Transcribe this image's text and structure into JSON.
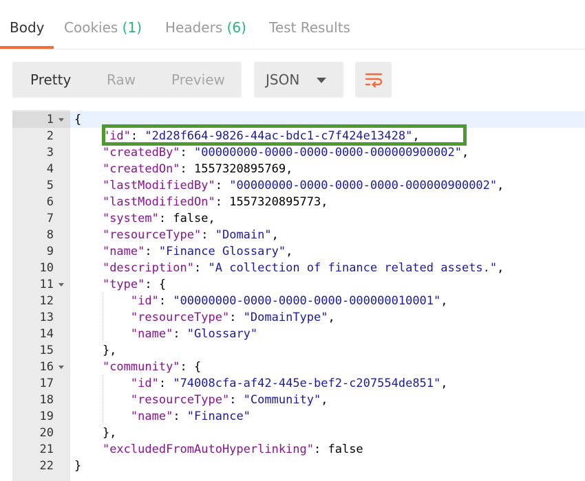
{
  "tabs": [
    {
      "label": "Body",
      "count": "",
      "active": true
    },
    {
      "label": "Cookies",
      "count": "(1)",
      "active": false
    },
    {
      "label": "Headers",
      "count": "(6)",
      "active": false
    },
    {
      "label": "Test Results",
      "count": "",
      "active": false
    }
  ],
  "view_modes": [
    "Pretty",
    "Raw",
    "Preview"
  ],
  "format_select": {
    "value": "JSON"
  },
  "wrap_button": {
    "icon": "wrap-lines-icon",
    "color": "#f26b3a"
  },
  "colors": {
    "accent": "#f26b3a",
    "count": "#26b47f",
    "key": "#881391",
    "string": "#1a1aa6",
    "highlight": "#4f9a30"
  },
  "editor": {
    "lines": [
      "1",
      "2",
      "3",
      "4",
      "5",
      "6",
      "7",
      "8",
      "9",
      "10",
      "11",
      "12",
      "13",
      "14",
      "15",
      "16",
      "17",
      "18",
      "19",
      "20",
      "21",
      "22"
    ],
    "code": [
      [
        {
          "t": "p",
          "v": "{"
        }
      ],
      [
        {
          "t": "p",
          "v": "    "
        },
        {
          "t": "k",
          "v": "\"id\""
        },
        {
          "t": "p",
          "v": ": "
        },
        {
          "t": "s",
          "v": "\"2d28f664-9826-44ac-bdc1-c7f424e13428\""
        },
        {
          "t": "p",
          "v": ","
        }
      ],
      [
        {
          "t": "p",
          "v": "    "
        },
        {
          "t": "k",
          "v": "\"createdBy\""
        },
        {
          "t": "p",
          "v": ": "
        },
        {
          "t": "s",
          "v": "\"00000000-0000-0000-0000-000000900002\""
        },
        {
          "t": "p",
          "v": ","
        }
      ],
      [
        {
          "t": "p",
          "v": "    "
        },
        {
          "t": "k",
          "v": "\"createdOn\""
        },
        {
          "t": "p",
          "v": ": "
        },
        {
          "t": "n",
          "v": "1557320895769"
        },
        {
          "t": "p",
          "v": ","
        }
      ],
      [
        {
          "t": "p",
          "v": "    "
        },
        {
          "t": "k",
          "v": "\"lastModifiedBy\""
        },
        {
          "t": "p",
          "v": ": "
        },
        {
          "t": "s",
          "v": "\"00000000-0000-0000-0000-000000900002\""
        },
        {
          "t": "p",
          "v": ","
        }
      ],
      [
        {
          "t": "p",
          "v": "    "
        },
        {
          "t": "k",
          "v": "\"lastModifiedOn\""
        },
        {
          "t": "p",
          "v": ": "
        },
        {
          "t": "n",
          "v": "1557320895773"
        },
        {
          "t": "p",
          "v": ","
        }
      ],
      [
        {
          "t": "p",
          "v": "    "
        },
        {
          "t": "k",
          "v": "\"system\""
        },
        {
          "t": "p",
          "v": ": "
        },
        {
          "t": "n",
          "v": "false"
        },
        {
          "t": "p",
          "v": ","
        }
      ],
      [
        {
          "t": "p",
          "v": "    "
        },
        {
          "t": "k",
          "v": "\"resourceType\""
        },
        {
          "t": "p",
          "v": ": "
        },
        {
          "t": "s",
          "v": "\"Domain\""
        },
        {
          "t": "p",
          "v": ","
        }
      ],
      [
        {
          "t": "p",
          "v": "    "
        },
        {
          "t": "k",
          "v": "\"name\""
        },
        {
          "t": "p",
          "v": ": "
        },
        {
          "t": "s",
          "v": "\"Finance Glossary\""
        },
        {
          "t": "p",
          "v": ","
        }
      ],
      [
        {
          "t": "p",
          "v": "    "
        },
        {
          "t": "k",
          "v": "\"description\""
        },
        {
          "t": "p",
          "v": ": "
        },
        {
          "t": "s",
          "v": "\"A collection of finance related assets.\""
        },
        {
          "t": "p",
          "v": ","
        }
      ],
      [
        {
          "t": "p",
          "v": "    "
        },
        {
          "t": "k",
          "v": "\"type\""
        },
        {
          "t": "p",
          "v": ": {"
        }
      ],
      [
        {
          "t": "p",
          "v": "        "
        },
        {
          "t": "k",
          "v": "\"id\""
        },
        {
          "t": "p",
          "v": ": "
        },
        {
          "t": "s",
          "v": "\"00000000-0000-0000-0000-000000010001\""
        },
        {
          "t": "p",
          "v": ","
        }
      ],
      [
        {
          "t": "p",
          "v": "        "
        },
        {
          "t": "k",
          "v": "\"resourceType\""
        },
        {
          "t": "p",
          "v": ": "
        },
        {
          "t": "s",
          "v": "\"DomainType\""
        },
        {
          "t": "p",
          "v": ","
        }
      ],
      [
        {
          "t": "p",
          "v": "        "
        },
        {
          "t": "k",
          "v": "\"name\""
        },
        {
          "t": "p",
          "v": ": "
        },
        {
          "t": "s",
          "v": "\"Glossary\""
        }
      ],
      [
        {
          "t": "p",
          "v": "    },"
        }
      ],
      [
        {
          "t": "p",
          "v": "    "
        },
        {
          "t": "k",
          "v": "\"community\""
        },
        {
          "t": "p",
          "v": ": {"
        }
      ],
      [
        {
          "t": "p",
          "v": "        "
        },
        {
          "t": "k",
          "v": "\"id\""
        },
        {
          "t": "p",
          "v": ": "
        },
        {
          "t": "s",
          "v": "\"74008cfa-af42-445e-bef2-c207554de851\""
        },
        {
          "t": "p",
          "v": ","
        }
      ],
      [
        {
          "t": "p",
          "v": "        "
        },
        {
          "t": "k",
          "v": "\"resourceType\""
        },
        {
          "t": "p",
          "v": ": "
        },
        {
          "t": "s",
          "v": "\"Community\""
        },
        {
          "t": "p",
          "v": ","
        }
      ],
      [
        {
          "t": "p",
          "v": "        "
        },
        {
          "t": "k",
          "v": "\"name\""
        },
        {
          "t": "p",
          "v": ": "
        },
        {
          "t": "s",
          "v": "\"Finance\""
        }
      ],
      [
        {
          "t": "p",
          "v": "    },"
        }
      ],
      [
        {
          "t": "p",
          "v": "    "
        },
        {
          "t": "k",
          "v": "\"excludedFromAutoHyperlinking\""
        },
        {
          "t": "p",
          "v": ": "
        },
        {
          "t": "n",
          "v": "false"
        }
      ],
      [
        {
          "t": "p",
          "v": "}"
        }
      ]
    ],
    "foldable_lines": [
      1,
      11,
      16
    ]
  }
}
